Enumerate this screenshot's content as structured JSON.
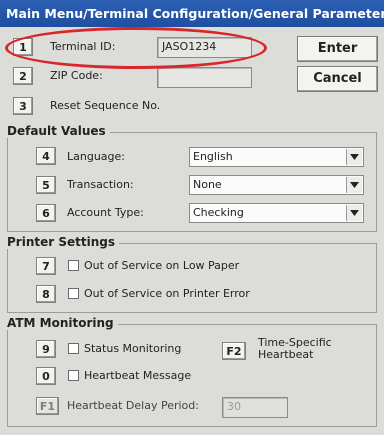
{
  "title": "Main Menu/Terminal Configuration/General Parameters",
  "top": {
    "terminal_id": {
      "key": "1",
      "label": "Terminal ID:",
      "value": "JASO1234"
    },
    "zip_code": {
      "key": "2",
      "label": "ZIP Code:",
      "value": ""
    },
    "reset_sequence": {
      "key": "3",
      "label": "Reset Sequence No."
    }
  },
  "buttons": {
    "enter": "Enter",
    "cancel": "Cancel"
  },
  "default_values": {
    "title": "Default Values",
    "language": {
      "key": "4",
      "label": "Language:",
      "value": "English"
    },
    "transaction": {
      "key": "5",
      "label": "Transaction:",
      "value": "None"
    },
    "account_type": {
      "key": "6",
      "label": "Account Type:",
      "value": "Checking"
    }
  },
  "printer_settings": {
    "title": "Printer Settings",
    "low_paper": {
      "key": "7",
      "label": "Out of Service on Low Paper",
      "checked": false
    },
    "printer_error": {
      "key": "8",
      "label": "Out of Service on Printer Error",
      "checked": false
    }
  },
  "atm_monitoring": {
    "title": "ATM Monitoring",
    "status_monitoring": {
      "key": "9",
      "label": "Status Monitoring",
      "checked": false
    },
    "heartbeat_message": {
      "key": "0",
      "label": "Heartbeat Message",
      "checked": false
    },
    "time_specific": {
      "key": "F2",
      "label_line1": "Time-Specific",
      "label_line2": "Heartbeat"
    },
    "heartbeat_delay": {
      "key": "F1",
      "label": "Heartbeat Delay Period:",
      "value": "30"
    }
  },
  "colors": {
    "titlebar": "#1f4fa0",
    "highlight_ellipse": "#d8262b",
    "window_bg": "#dcdcd8"
  },
  "icons": {
    "dropdown": "chevron-down-icon",
    "checkbox": "checkbox-icon"
  }
}
